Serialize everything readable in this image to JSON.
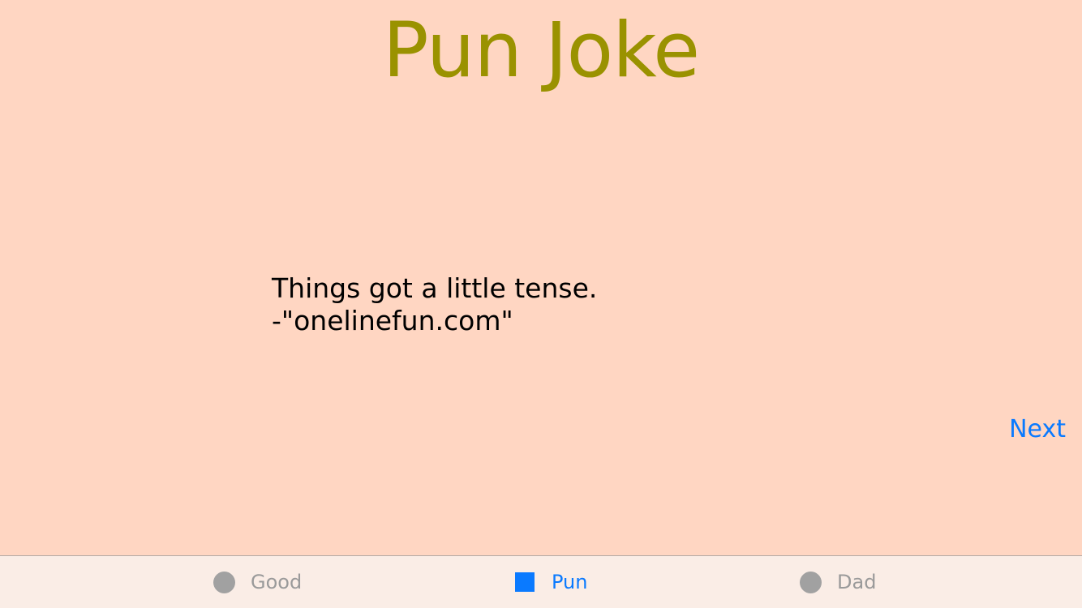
{
  "header": {
    "title": "Pun Joke"
  },
  "joke": {
    "line1": "Things got a little tense.",
    "line2": "-\"onelinefun.com\""
  },
  "actions": {
    "next_label": "Next"
  },
  "tabs": [
    {
      "label": "Good",
      "icon": "circle-icon",
      "active": false
    },
    {
      "label": "Pun",
      "icon": "square-icon",
      "active": true
    },
    {
      "label": "Dad",
      "icon": "circle-icon",
      "active": false
    }
  ],
  "colors": {
    "background": "#FFD6C2",
    "title": "#9A9200",
    "accent": "#0A7AFF",
    "tabbar": "#FAEDE6",
    "inactive": "#A1A1A1"
  }
}
